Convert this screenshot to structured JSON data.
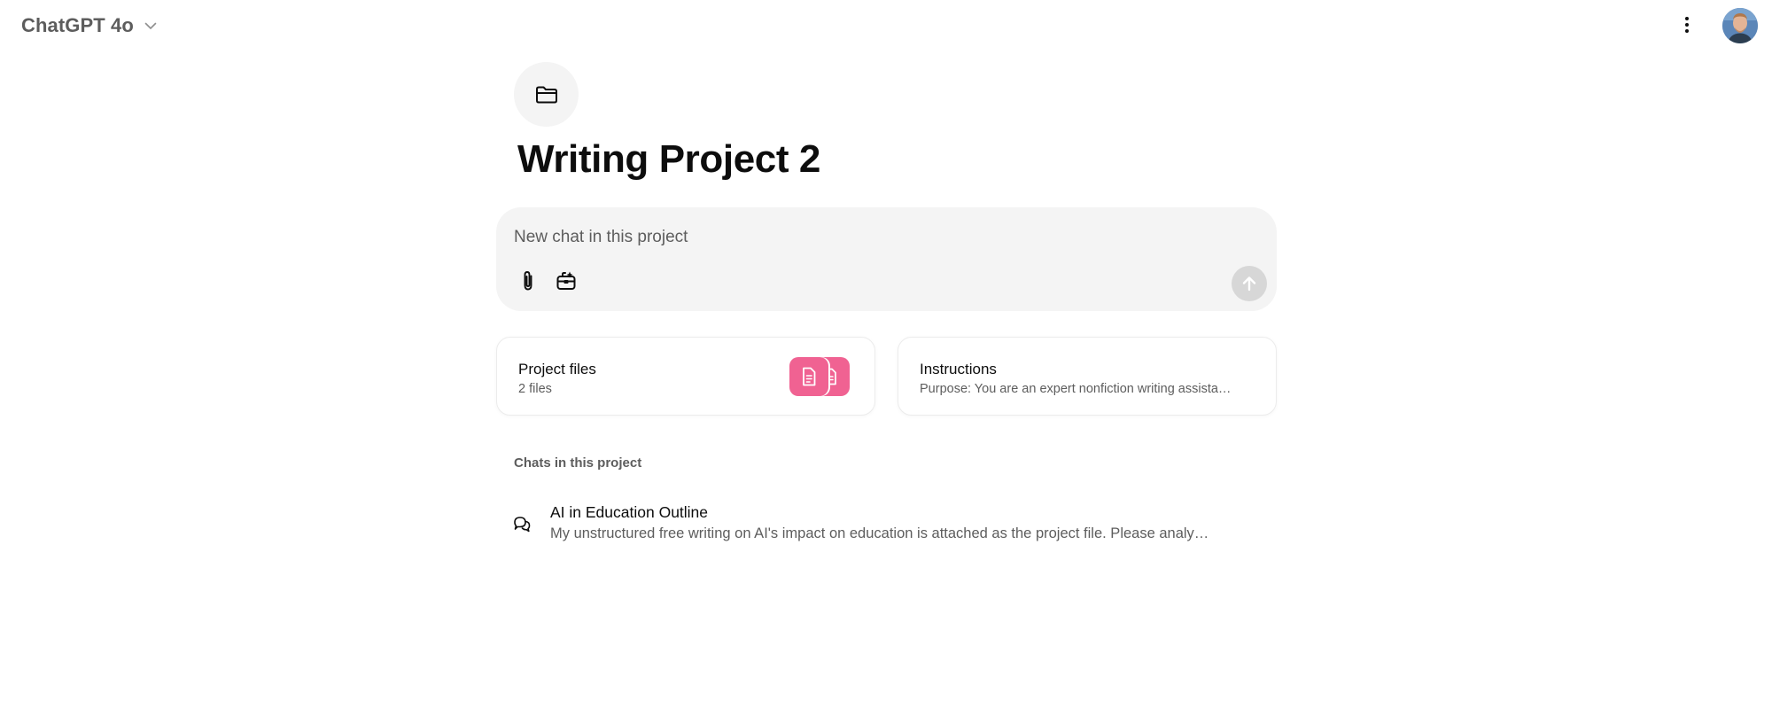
{
  "header": {
    "model_label": "ChatGPT 4o",
    "model_chevron_icon": "chevron-down-icon",
    "more_icon": "vertical-dots-icon",
    "avatar_icon": "user-avatar"
  },
  "project": {
    "icon": "folder-icon",
    "title": "Writing Project 2"
  },
  "composer": {
    "placeholder": "New chat in this project",
    "value": "",
    "attach_icon": "paperclip-icon",
    "tools_icon": "toolbox-icon",
    "send_icon": "arrow-up-icon"
  },
  "cards": {
    "files": {
      "title": "Project files",
      "subtitle": "2 files",
      "icon": "document-icon"
    },
    "instructions": {
      "title": "Instructions",
      "subtitle": "Purpose: You are an expert nonfiction writing assista…"
    }
  },
  "chats": {
    "section_label": "Chats in this project",
    "items": [
      {
        "icon": "chat-bubbles-icon",
        "title": "AI in Education Outline",
        "preview": "My unstructured free writing on AI's impact on education is attached as the project file. Please analy…"
      }
    ]
  },
  "colors": {
    "accent_file_tile": "#f06292",
    "composer_bg": "#f4f4f4",
    "send_disabled": "#d7d7d7",
    "muted_text": "#5d5d5d"
  }
}
